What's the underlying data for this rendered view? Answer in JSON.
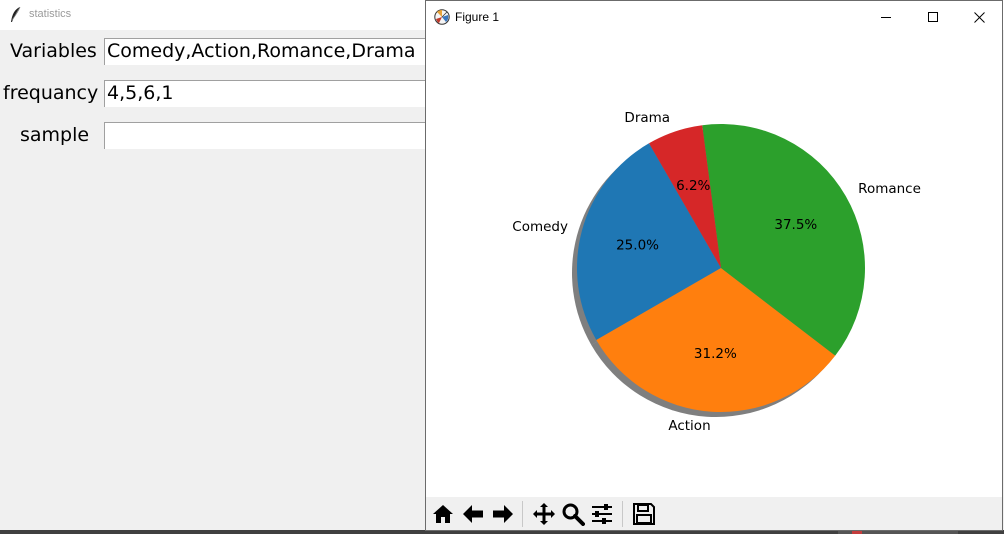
{
  "tk_window": {
    "title": "statistics",
    "rows": [
      {
        "label": "Variables",
        "value": "Comedy,Action,Romance,Drama"
      },
      {
        "label": "frequancy",
        "value": "4,5,6,1"
      },
      {
        "label": "sample",
        "value": ""
      }
    ]
  },
  "figure_window": {
    "title": "Figure 1",
    "title_icon": "matplotlib-icon",
    "window_controls": [
      "minimize-icon",
      "maximize-icon",
      "close-icon"
    ],
    "toolbar": [
      "home-icon",
      "back-arrow-icon",
      "forward-arrow-icon",
      "pan-icon",
      "zoom-icon",
      "configure-subplots-icon",
      "save-icon"
    ]
  },
  "chart_data": {
    "type": "pie",
    "categories": [
      "Comedy",
      "Action",
      "Romance",
      "Drama"
    ],
    "values": [
      4,
      5,
      6,
      1
    ],
    "percent_labels": [
      "25.0%",
      "31.2%",
      "37.5%",
      "6.2%"
    ],
    "colors": [
      "#1f77b4",
      "#ff7f0e",
      "#2ca02c",
      "#d62728"
    ],
    "start_angle": 120,
    "shadow": true
  }
}
